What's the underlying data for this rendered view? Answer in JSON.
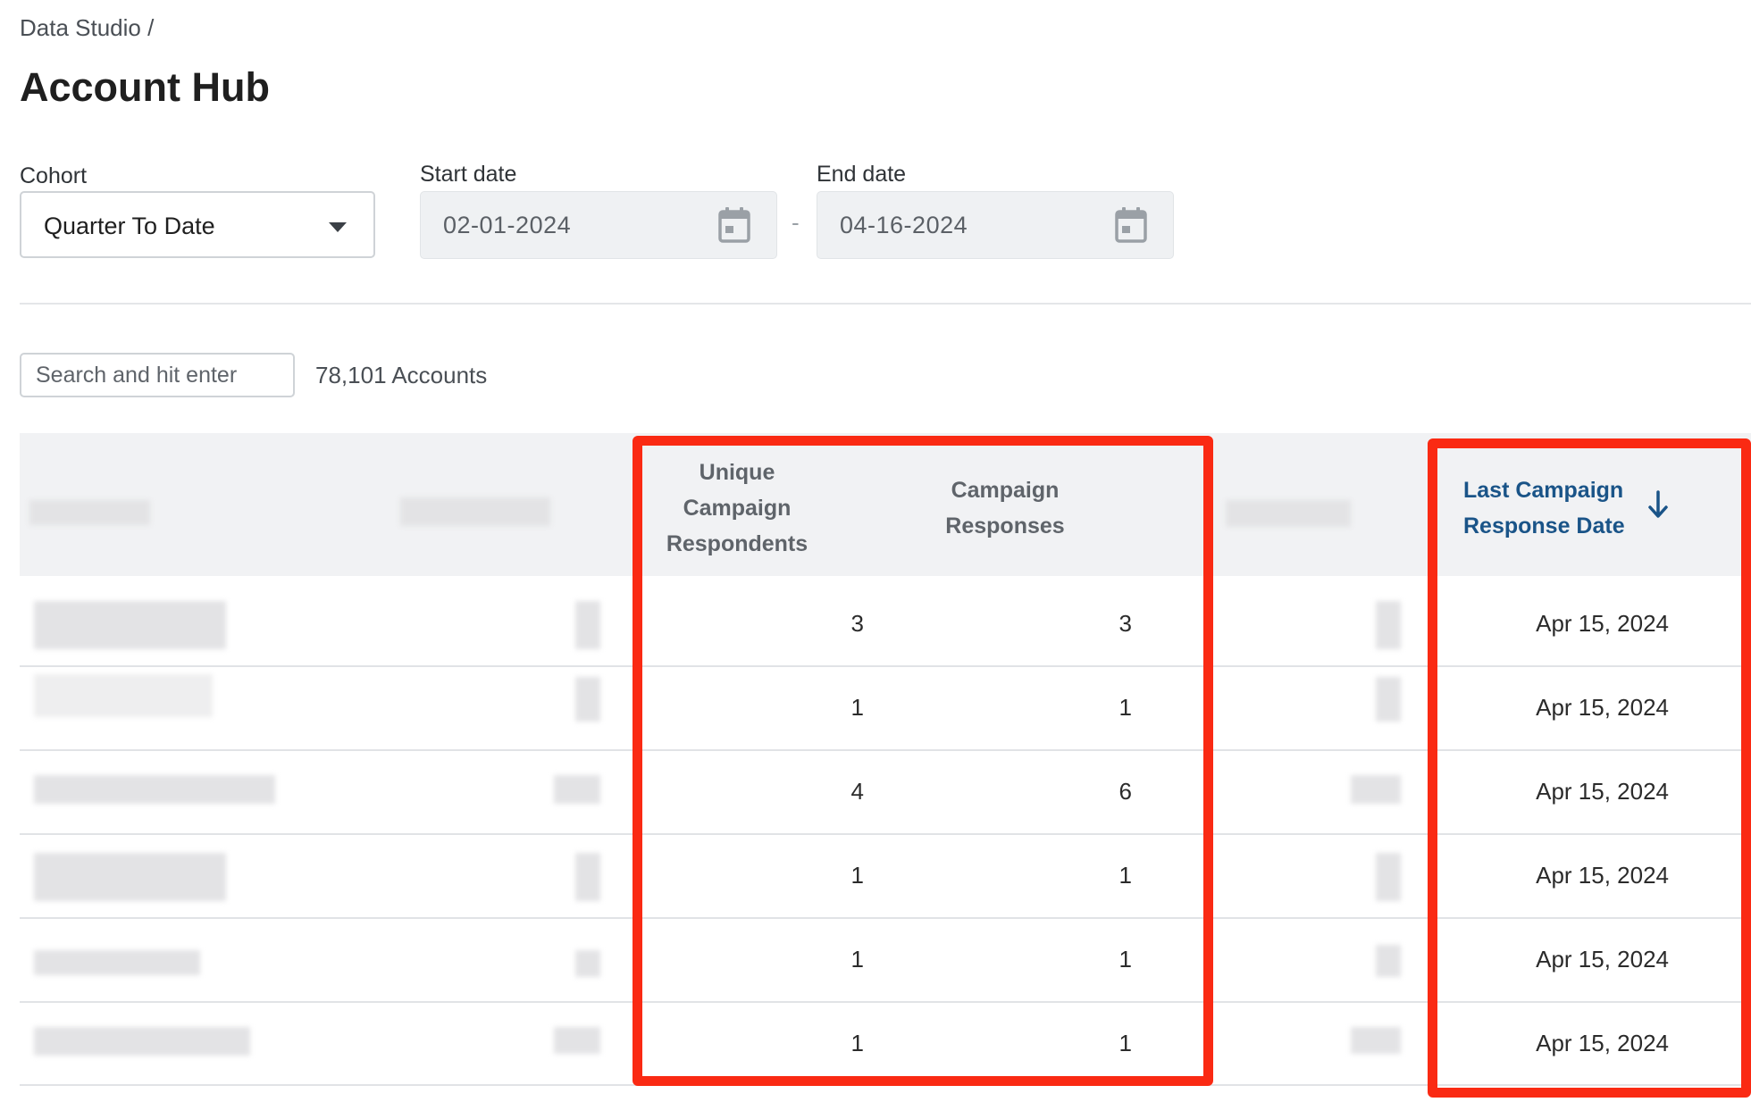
{
  "breadcrumb": "Data Studio /",
  "title": "Account Hub",
  "filters": {
    "cohort_label": "Cohort",
    "cohort_value": "Quarter To Date",
    "start_label": "Start date",
    "start_value": "02-01-2024",
    "end_label": "End date",
    "end_value": "04-16-2024",
    "separator": "-"
  },
  "search": {
    "placeholder": "Search and hit enter"
  },
  "account_count": "78,101 Accounts",
  "table": {
    "columns": {
      "unique_respondents": [
        "Unique",
        "Campaign",
        "Respondents"
      ],
      "campaign_responses": [
        "Campaign",
        "Responses"
      ],
      "last_response_date": [
        "Last Campaign",
        "Response Date"
      ]
    },
    "rows": [
      {
        "unique": "3",
        "responses": "3",
        "date": "Apr 15, 2024"
      },
      {
        "unique": "1",
        "responses": "1",
        "date": "Apr 15, 2024"
      },
      {
        "unique": "4",
        "responses": "6",
        "date": "Apr 15, 2024"
      },
      {
        "unique": "1",
        "responses": "1",
        "date": "Apr 15, 2024"
      },
      {
        "unique": "1",
        "responses": "1",
        "date": "Apr 15, 2024"
      },
      {
        "unique": "1",
        "responses": "1",
        "date": "Apr 15, 2024"
      }
    ]
  },
  "icons": {
    "cohort_dropdown": "caret-down-icon",
    "date_picker": "calendar-icon",
    "sort": "arrow-down-icon"
  },
  "colors": {
    "highlight": "#fa2a13",
    "sorted_header": "#1a5488"
  }
}
